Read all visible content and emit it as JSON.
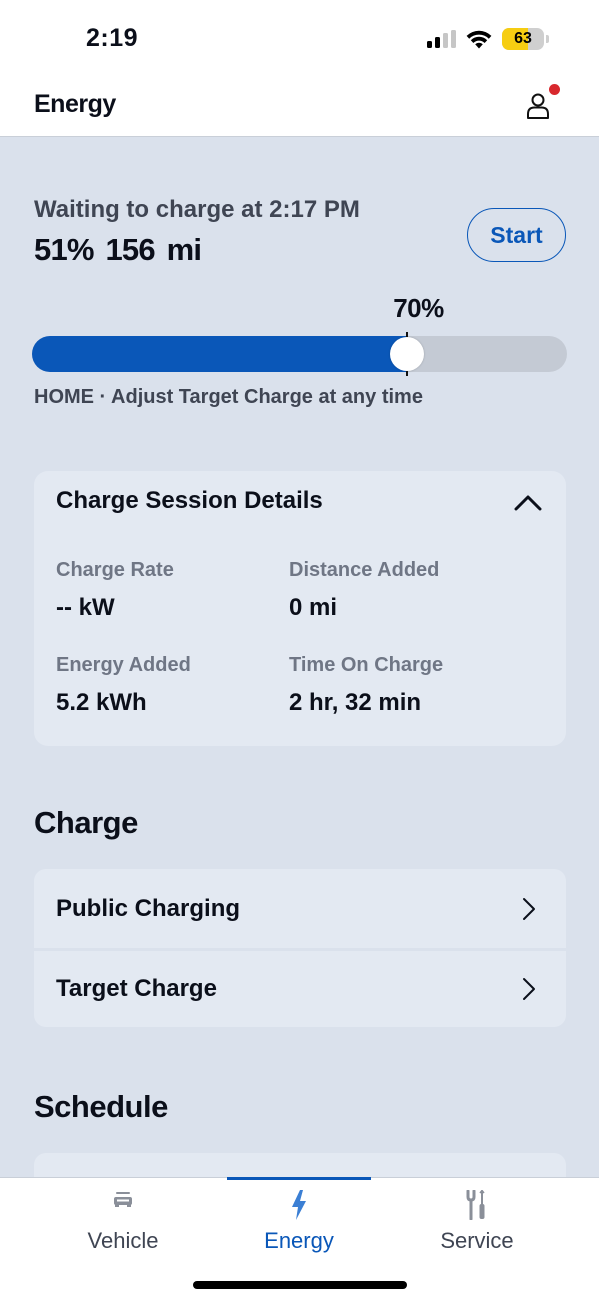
{
  "status_bar": {
    "time": "2:19",
    "battery_percent": 63,
    "battery_label": "63",
    "signal_bars_active": 2,
    "signal_bars_total": 4,
    "battery_color": "#f6cd12"
  },
  "header": {
    "title": "Energy",
    "profile_icon": "person-icon",
    "has_notification": true,
    "notification_color": "#d8282d"
  },
  "charge_status": {
    "waiting_text": "Waiting to charge at 2:17 PM",
    "level_text": "51%  156 mi",
    "start_button_label": "Start",
    "target_label": "70%",
    "target_percent": 70,
    "fill_percent": 70,
    "location_note": "HOME · Adjust Target Charge at any time",
    "accent_color": "#0a57b8"
  },
  "session_details": {
    "title": "Charge Session Details",
    "expanded": true,
    "metrics": [
      {
        "label": "Charge Rate",
        "value": "-- kW"
      },
      {
        "label": "Distance Added",
        "value": "0 mi"
      },
      {
        "label": "Energy Added",
        "value": "5.2 kWh"
      },
      {
        "label": "Time On Charge",
        "value": "2 hr, 32 min"
      }
    ]
  },
  "charge_section": {
    "heading": "Charge",
    "items": [
      {
        "label": "Public Charging"
      },
      {
        "label": "Target Charge"
      }
    ]
  },
  "schedule_section": {
    "heading": "Schedule"
  },
  "tabbar": {
    "tabs": [
      {
        "label": "Vehicle",
        "icon": "car-icon",
        "active": false
      },
      {
        "label": "Energy",
        "icon": "lightning-bolt-icon",
        "active": true
      },
      {
        "label": "Service",
        "icon": "tools-icon",
        "active": false
      }
    ]
  }
}
